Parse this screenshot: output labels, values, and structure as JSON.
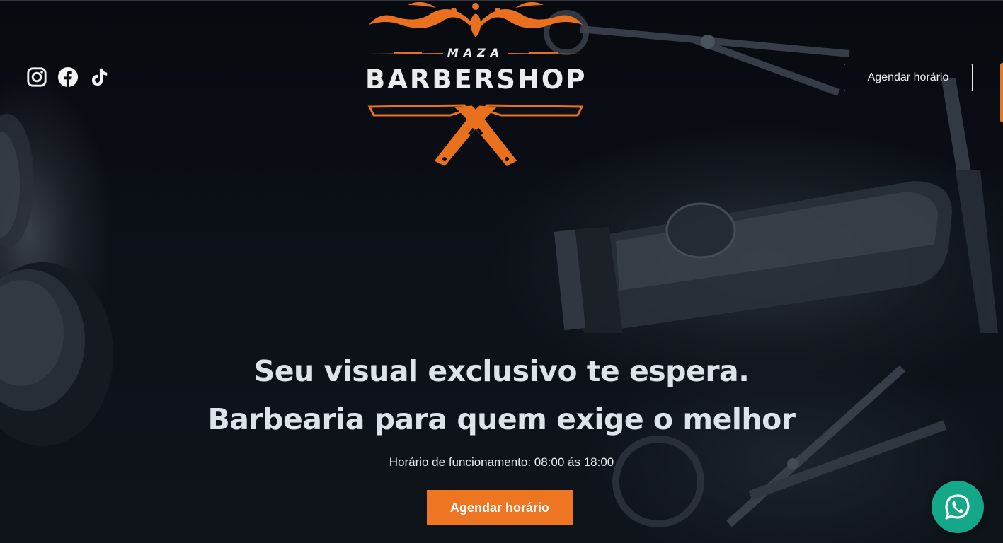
{
  "header": {
    "socials": [
      {
        "icon": "instagram-icon"
      },
      {
        "icon": "facebook-icon"
      },
      {
        "icon": "tiktok-icon"
      }
    ],
    "logo": {
      "brand_top": "MAZA",
      "brand_main": "BARBERSHOP"
    },
    "schedule_button": "Agendar horário"
  },
  "hero": {
    "headline_line1": "Seu visual exclusivo te espera.",
    "headline_line2": "Barbearia para quem exige o melhor",
    "hours": "Horário de funcionamento: 08:00 ás 18:00",
    "cta_label": "Agendar horário"
  },
  "floating": {
    "whatsapp_icon": "whatsapp-icon"
  },
  "colors": {
    "accent": "#ee7622",
    "logo_orange": "#e8701f",
    "background": "#0b0f16",
    "text": "#dde4e9",
    "whatsapp": "#14a889"
  }
}
